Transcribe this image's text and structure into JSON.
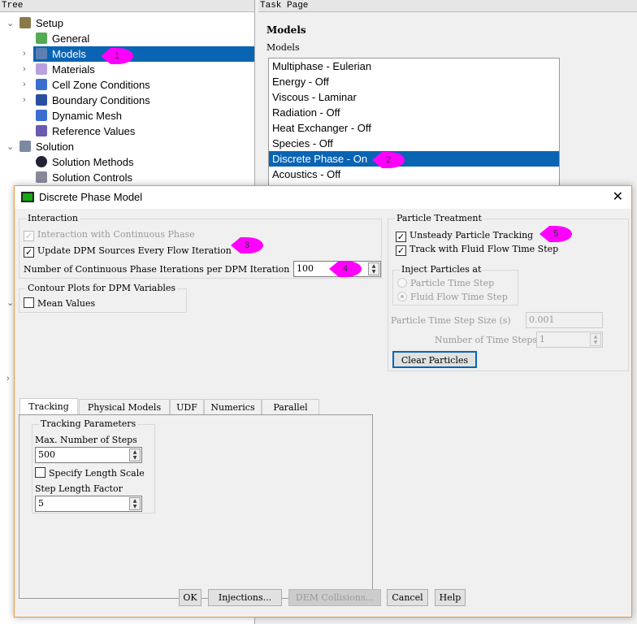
{
  "tree": {
    "header": "Tree",
    "items": [
      {
        "label": "Setup",
        "icon": "setup-icon"
      },
      {
        "label": "General",
        "icon": "general-icon"
      },
      {
        "label": "Models",
        "icon": "models-icon"
      },
      {
        "label": "Materials",
        "icon": "materials-icon"
      },
      {
        "label": "Cell Zone Conditions",
        "icon": "cell-zone-icon"
      },
      {
        "label": "Boundary Conditions",
        "icon": "boundary-icon"
      },
      {
        "label": "Dynamic Mesh",
        "icon": "dynamic-mesh-icon"
      },
      {
        "label": "Reference Values",
        "icon": "reference-icon"
      },
      {
        "label": "Solution",
        "icon": "solution-icon"
      },
      {
        "label": "Solution Methods",
        "icon": "methods-icon"
      },
      {
        "label": "Solution Controls",
        "icon": "controls-icon"
      }
    ]
  },
  "task": {
    "header": "Task Page",
    "title": "Models",
    "list_label": "Models",
    "models": [
      "Multiphase - Eulerian",
      "Energy - Off",
      "Viscous - Laminar",
      "Radiation - Off",
      "Heat Exchanger - Off",
      "Species - Off",
      "Discrete Phase - On",
      "Acoustics - Off"
    ]
  },
  "annotations": [
    "1",
    "2",
    "3",
    "4",
    "5"
  ],
  "dialog": {
    "title": "Discrete Phase Model",
    "interaction": {
      "label": "Interaction",
      "continuous": "Interaction with Continuous Phase",
      "update": "Update DPM Sources Every Flow Iteration",
      "iters_label": "Number of Continuous Phase Iterations per DPM Iteration",
      "iters_value": "100"
    },
    "contour": {
      "label": "Contour Plots for DPM Variables",
      "mean": "Mean Values"
    },
    "particle": {
      "label": "Particle Treatment",
      "unsteady": "Unsteady Particle Tracking",
      "track": "Track with Fluid Flow Time Step",
      "inject_label": "Inject Particles at",
      "opt1": "Particle Time Step",
      "opt2": "Fluid Flow Time Step",
      "ts_label": "Particle Time Step Size (s)",
      "ts_value": "0.001",
      "nts_label": "Number of Time Steps",
      "nts_value": "1",
      "clear": "Clear Particles"
    },
    "tabs": [
      "Tracking",
      "Physical Models",
      "UDF",
      "Numerics",
      "Parallel"
    ],
    "tracking": {
      "label": "Tracking Parameters",
      "max_label": "Max. Number of Steps",
      "max_value": "500",
      "specify": "Specify Length Scale",
      "factor_label": "Step Length Factor",
      "factor_value": "5"
    },
    "buttons": {
      "ok": "OK",
      "injections": "Injections...",
      "dem": "DEM Collisions...",
      "cancel": "Cancel",
      "help": "Help"
    }
  },
  "colors": {
    "selection": "#0a64b4",
    "annotation": "#ff00ff",
    "dialog_border": "#e39a4c"
  }
}
